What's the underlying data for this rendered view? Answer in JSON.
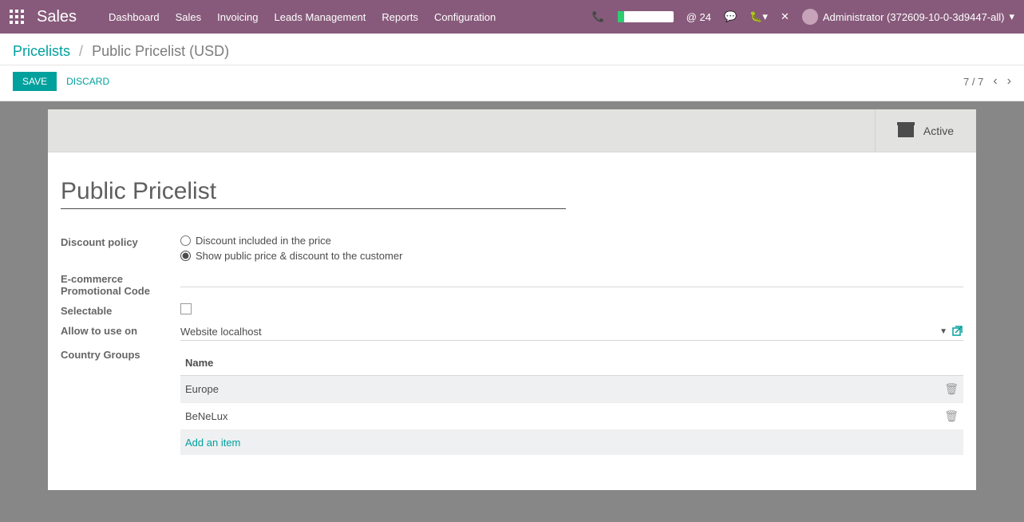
{
  "topbar": {
    "app_title": "Sales",
    "nav": [
      "Dashboard",
      "Sales",
      "Invoicing",
      "Leads Management",
      "Reports",
      "Configuration"
    ],
    "msg_count": "@ 24",
    "user": "Administrator (372609-10-0-3d9447-all)"
  },
  "breadcrumb": {
    "root": "Pricelists",
    "sep": "/",
    "current": "Public Pricelist (USD)"
  },
  "actions": {
    "save": "SAVE",
    "discard": "DISCARD"
  },
  "pager": {
    "text": "7 / 7"
  },
  "statusbar": {
    "active": "Active"
  },
  "form": {
    "title": "Public Pricelist",
    "labels": {
      "discount_policy": "Discount policy",
      "ecommerce": "E-commerce Promotional Code",
      "selectable": "Selectable",
      "allow_use": "Allow to use on",
      "country_groups": "Country Groups"
    },
    "discount_options": {
      "included": "Discount included in the price",
      "show_public": "Show public price & discount to the customer"
    },
    "allow_use_value": "Website localhost",
    "table": {
      "header": "Name",
      "rows": [
        "Europe",
        "BeNeLux"
      ],
      "add": "Add an item"
    }
  }
}
